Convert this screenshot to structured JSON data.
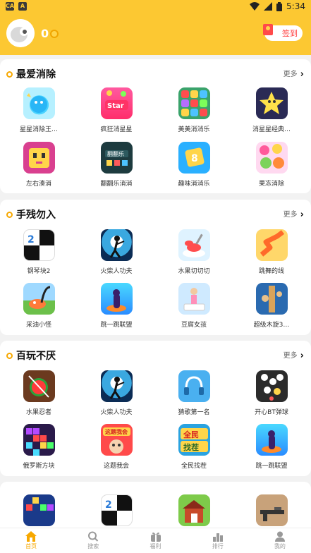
{
  "status_bar": {
    "time": "5:34",
    "left_icons": [
      "CA",
      "A"
    ]
  },
  "header": {
    "coin_count": "0",
    "signin_label": "签到"
  },
  "sections": [
    {
      "title": "最爱消除",
      "more_label": "更多",
      "games": [
        {
          "name": "星星消除王…"
        },
        {
          "name": "疯狂消星星"
        },
        {
          "name": "美美消消乐"
        },
        {
          "name": "消星星经典…"
        },
        {
          "name": "左右湊消"
        },
        {
          "name": "翻翻乐消消"
        },
        {
          "name": "趣味消消乐"
        },
        {
          "name": "果冻消除"
        }
      ]
    },
    {
      "title": "手残勿入",
      "more_label": "更多",
      "games": [
        {
          "name": "钢琴块2"
        },
        {
          "name": "火柴人功夫"
        },
        {
          "name": "水果切切切"
        },
        {
          "name": "跳舞的线"
        },
        {
          "name": "采油小怪"
        },
        {
          "name": "跳一跳联盟"
        },
        {
          "name": "豆腐女孩"
        },
        {
          "name": "超级木旋3…"
        }
      ]
    },
    {
      "title": "百玩不厌",
      "more_label": "更多",
      "games": [
        {
          "name": "水果忍者"
        },
        {
          "name": "火柴人功夫"
        },
        {
          "name": "猜歌第一名"
        },
        {
          "name": "开心BT弹球"
        },
        {
          "name": "俄罗斯方块"
        },
        {
          "name": "这题我会"
        },
        {
          "name": "全民找茬"
        },
        {
          "name": "跳一跳联盟"
        }
      ]
    }
  ],
  "tabbar": [
    {
      "label": "首页",
      "icon": "home-icon"
    },
    {
      "label": "搜索",
      "icon": "search-icon"
    },
    {
      "label": "福利",
      "icon": "gift-icon"
    },
    {
      "label": "排行",
      "icon": "ranking-icon"
    },
    {
      "label": "我的",
      "icon": "user-icon"
    }
  ],
  "colors": {
    "brand": "#fcc832",
    "accent": "#f7a800",
    "signin_text": "#ff3b3b"
  }
}
